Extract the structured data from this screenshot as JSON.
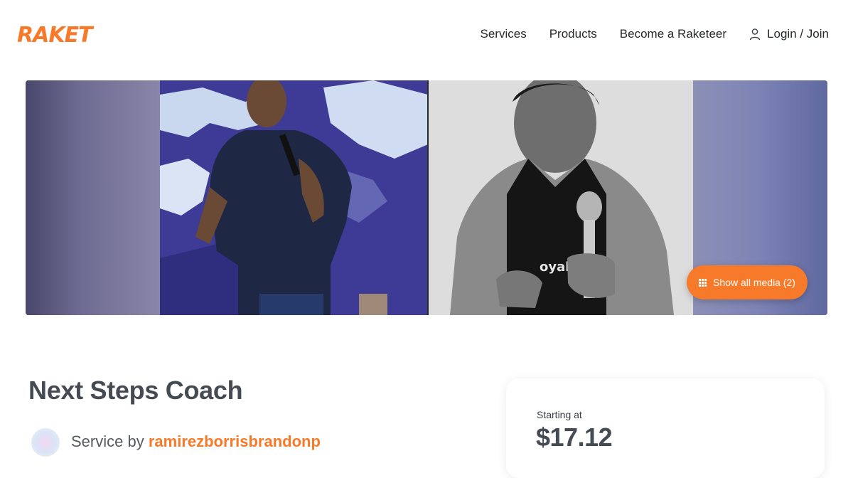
{
  "header": {
    "logo_text": "RAKET",
    "nav": {
      "services": "Services",
      "products": "Products",
      "become": "Become a Raketeer",
      "login": "Login / Join"
    }
  },
  "gallery": {
    "media_button_label": "Show all media (2)",
    "photo_count": 2
  },
  "listing": {
    "title": "Next Steps Coach",
    "service_by_prefix": "Service by",
    "author": "ramirezborrisbrandonp"
  },
  "pricing": {
    "starting_label": "Starting at",
    "price": "$17.12"
  },
  "colors": {
    "brand": "#f7792a",
    "heading": "#454b52",
    "text": "#25292c"
  },
  "icons": {
    "login": "user-icon",
    "media": "grid-icon"
  }
}
